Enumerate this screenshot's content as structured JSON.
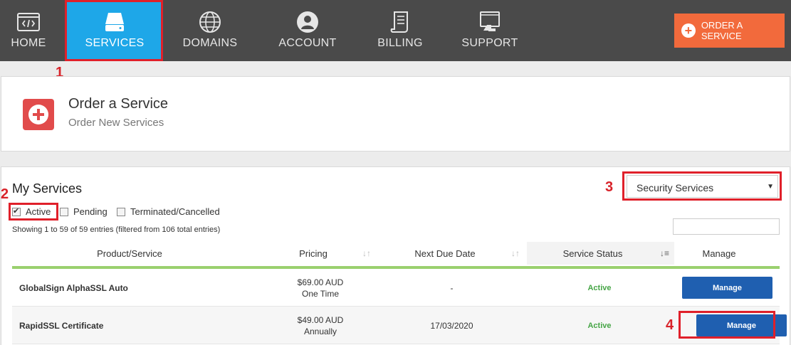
{
  "nav": {
    "items": [
      {
        "label": "HOME",
        "icon": "code-window-icon"
      },
      {
        "label": "SERVICES",
        "icon": "server-icon"
      },
      {
        "label": "DOMAINS",
        "icon": "globe-icon"
      },
      {
        "label": "ACCOUNT",
        "icon": "user-circle-icon"
      },
      {
        "label": "BILLING",
        "icon": "receipt-icon"
      },
      {
        "label": "SUPPORT",
        "icon": "monitor-support-icon"
      }
    ],
    "order_button": "ORDER A SERVICE"
  },
  "annotations": [
    "1",
    "2",
    "3",
    "4"
  ],
  "order_panel": {
    "title": "Order a Service",
    "subtitle": "Order New Services"
  },
  "services": {
    "title": "My Services",
    "filters": [
      {
        "label": "Active",
        "checked": true
      },
      {
        "label": "Pending",
        "checked": false
      },
      {
        "label": "Terminated/Cancelled",
        "checked": false
      }
    ],
    "showing": "Showing 1 to 59 of 59 entries (filtered from 106 total entries)",
    "category_select": "Security Services",
    "columns": [
      "Product/Service",
      "Pricing",
      "Next Due Date",
      "Service Status",
      "Manage"
    ],
    "rows": [
      {
        "name": "GlobalSign AlphaSSL Auto",
        "price": "$69.00 AUD",
        "cycle": "One Time",
        "due": "-",
        "status": "Active",
        "manage": "Manage"
      },
      {
        "name": "RapidSSL Certificate",
        "price": "$49.00 AUD",
        "cycle": "Annually",
        "due": "17/03/2020",
        "status": "Active",
        "manage": "Manage"
      }
    ]
  },
  "colors": {
    "nav_bg": "#4a4a4a",
    "nav_active": "#1ea7e8",
    "order_button": "#f26a3c",
    "highlight": "#e0202a",
    "manage_button": "#1f5fb0",
    "status_active": "#46a546",
    "table_accent": "#9ad06e"
  }
}
